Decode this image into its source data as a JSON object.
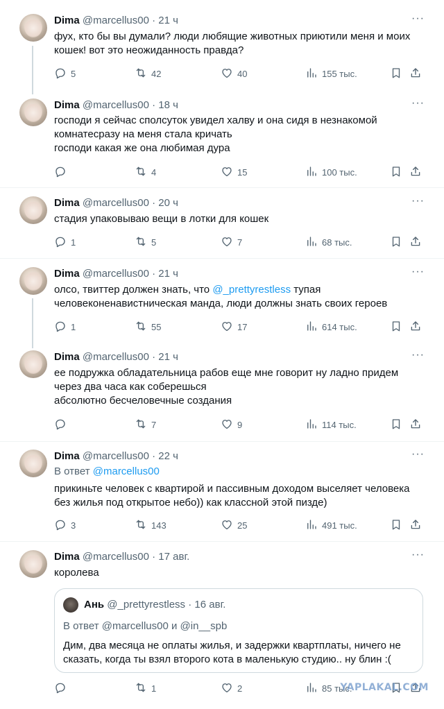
{
  "tweets": [
    {
      "name": "Dima",
      "handle": "@marcellus00",
      "time": "21 ч",
      "lines": [
        "фух, кто бы вы думали? люди любящие животных приютили меня и моих",
        "кошек! вот это неожиданность правда?"
      ],
      "replies": "5",
      "retweets": "42",
      "likes": "40",
      "views": "155 тыс."
    },
    {
      "name": "Dima",
      "handle": "@marcellus00",
      "time": "18 ч",
      "lines": [
        "господи я сейчас спол­суток увидел халву и она сидя в незнакомой",
        "комнатесразу на меня стала кричать",
        "господи какая же она любимая дура"
      ],
      "replies": "",
      "retweets": "4",
      "likes": "15",
      "views": "100 тыс."
    },
    {
      "name": "Dima",
      "handle": "@marcellus00",
      "time": "20 ч",
      "lines": [
        "стадия упаковываю вещи в лотки для кошек"
      ],
      "replies": "1",
      "retweets": "5",
      "likes": "7",
      "views": "68 тыс."
    },
    {
      "name": "Dima",
      "handle": "@marcellus00",
      "time": "21 ч",
      "line1_pre": "олсо, твиттер должен знать, что ",
      "line1_link": "@_prettyrestless",
      "line1_post": " тупая",
      "lines": [
        "человеконенавистническая манда, люди должны знать своих героев"
      ],
      "replies": "1",
      "retweets": "55",
      "likes": "17",
      "views": "614 тыс."
    },
    {
      "name": "Dima",
      "handle": "@marcellus00",
      "time": "21 ч",
      "lines": [
        "ее подружка обладательница рабов еще мне говорит ну ладно придем",
        "через два часа как соберешься",
        "абсолютно бесчеловечные создания"
      ],
      "replies": "",
      "retweets": "7",
      "likes": "9",
      "views": "114 тыс."
    },
    {
      "name": "Dima",
      "handle": "@marcellus00",
      "time": "22 ч",
      "reply_prefix": "В ответ ",
      "reply_link": "@marcellus00",
      "lines": [
        "прикиньте человек с квартирой и пассивным доходом выселяет человека",
        "без жилья под открытое небо)) как классной этой пизде)"
      ],
      "replies": "3",
      "retweets": "143",
      "likes": "25",
      "views": "491 тыс."
    },
    {
      "name": "Dima",
      "handle": "@marcellus00",
      "time": "17 авг.",
      "lines": [
        "королева"
      ],
      "replies": "",
      "retweets": "1",
      "likes": "2",
      "views": "85 тыс."
    }
  ],
  "quote": {
    "name": "Ань",
    "handle": "@_prettyrestless",
    "time": "16 авг.",
    "reply_text": "В ответ @marcellus00 и @in__spb",
    "lines": [
      "Дим, два месяца не оплаты жилья, и задержки квартплаты, ничего не",
      "сказать, когда ты взял второго кота в маленькую студию.. ну блин :("
    ]
  },
  "separator": "·",
  "more_glyph": "···",
  "watermark": "YAPLAKAL.COM",
  "colors": {
    "link": "#1d9bf0",
    "secondary": "#536471",
    "thread_line": "#cfd9de"
  },
  "icons": [
    "reply-icon",
    "retweet-icon",
    "like-icon",
    "views-icon",
    "bookmark-icon",
    "share-icon",
    "more-icon"
  ]
}
